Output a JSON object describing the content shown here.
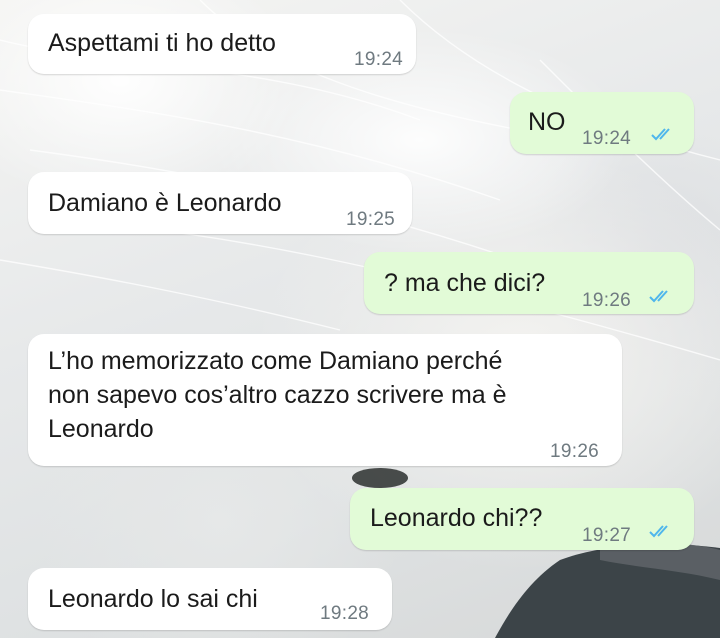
{
  "chat": {
    "messages": [
      {
        "direction": "incoming",
        "text": "Aspettami ti ho detto",
        "time": "19:24"
      },
      {
        "direction": "outgoing",
        "text": "NO",
        "time": "19:24",
        "status": "read-double-check"
      },
      {
        "direction": "incoming",
        "text": "Damiano è Leonardo",
        "time": "19:25"
      },
      {
        "direction": "outgoing",
        "text": "? ma che dici?",
        "time": "19:26",
        "status": "read-double-check"
      },
      {
        "direction": "incoming",
        "text": "L’ho memorizzato come Damiano perché\nnon sapevo cos’altro cazzo scrivere ma è\nLeonardo",
        "time": "19:26"
      },
      {
        "direction": "outgoing",
        "text": "Leonardo chi??",
        "time": "19:27",
        "status": "read-double-check"
      },
      {
        "direction": "incoming",
        "text": "Leonardo lo sai chi",
        "time": "19:28"
      }
    ]
  },
  "colors": {
    "incoming_bubble": "#ffffff",
    "outgoing_bubble": "#e2fbd7",
    "read_ticks": "#4fb6ec",
    "timestamp": "#6f7a80"
  },
  "icons": {
    "read_receipt": "double-check-icon"
  }
}
